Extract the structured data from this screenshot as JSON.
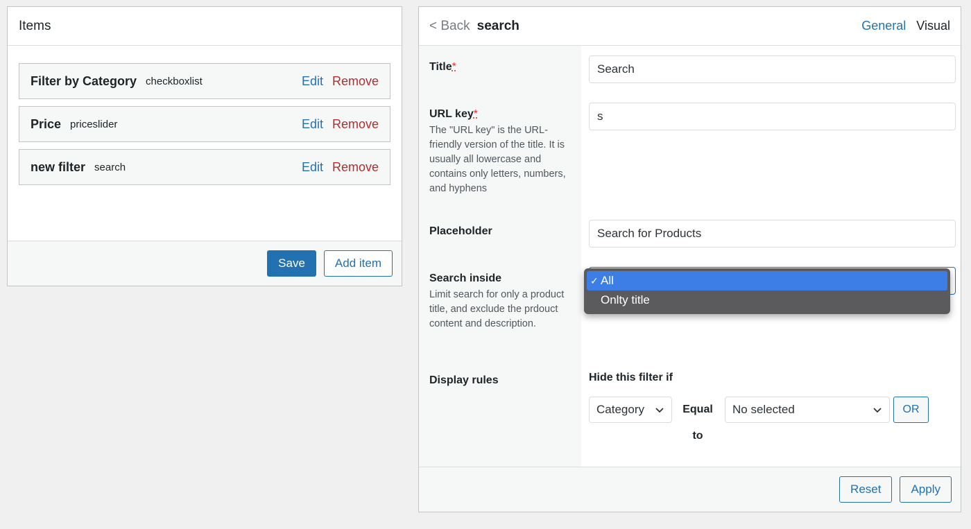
{
  "items_panel": {
    "title": "Items",
    "items": [
      {
        "name": "Filter by Category",
        "type": "checkboxlist",
        "edit": "Edit",
        "remove": "Remove"
      },
      {
        "name": "Price",
        "type": "priceslider",
        "edit": "Edit",
        "remove": "Remove"
      },
      {
        "name": "new filter",
        "type": "search",
        "edit": "Edit",
        "remove": "Remove"
      }
    ],
    "save_label": "Save",
    "add_item_label": "Add item"
  },
  "settings_panel": {
    "back_label": "< Back",
    "filter_name": "search",
    "tabs": [
      {
        "label": "General"
      },
      {
        "label": "Visual"
      }
    ],
    "required_mark": "*",
    "title_field": {
      "label": "Title",
      "value": "Search"
    },
    "url_key_field": {
      "label": "URL key",
      "description": "The \"URL key\" is the URL-friendly version of the title. It is usually all lowercase and contains only letters, numbers, and hyphens",
      "value": "s"
    },
    "placeholder_field": {
      "label": "Placeholder",
      "value": "Search for Products"
    },
    "search_inside_field": {
      "label": "Search inside",
      "description": "Limit search for only a product title, and exclude the prdouct content and description.",
      "options": [
        {
          "label": "All",
          "selected": true,
          "check": "✓"
        },
        {
          "label": "Onlty title",
          "selected": false
        }
      ]
    },
    "display_rules": {
      "label": "Display rules",
      "heading": "Hide this filter if",
      "field_select": "Category",
      "operator": "Equal to",
      "value_select": "No selected",
      "or_label": "OR"
    },
    "reset_label": "Reset",
    "apply_label": "Apply"
  },
  "colors": {
    "accent": "#2271b1",
    "danger": "#b32d2e",
    "dropdown_bg": "#5b5b5e",
    "dropdown_selected": "#3d7ee6"
  }
}
